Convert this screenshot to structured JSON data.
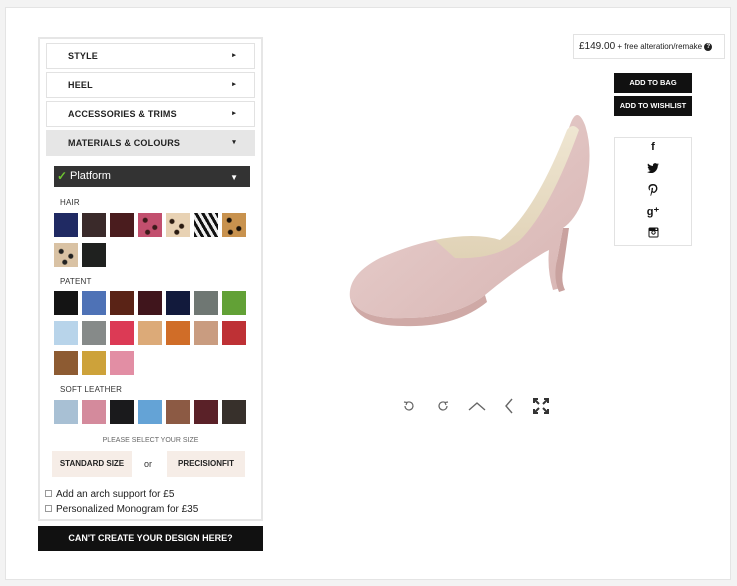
{
  "menu": [
    {
      "label": "STYLE",
      "arrow": "▸"
    },
    {
      "label": "HEEL",
      "arrow": "▸"
    },
    {
      "label": "ACCESSORIES & TRIMS",
      "arrow": "▸"
    },
    {
      "label": "MATERIALS & COLOURS",
      "arrow": "▾"
    }
  ],
  "material_select": {
    "check": "✓",
    "value": "Platform",
    "caret": "▼"
  },
  "sections": {
    "hair": "HAIR",
    "patent": "PATENT",
    "soft_leather": "SOFT LEATHER"
  },
  "swatches": {
    "hair": [
      "#202a63",
      "#3a2a2a",
      "#4a1c1e",
      "leopard-pink",
      "leopard-tan",
      "zebra",
      "leopard-brown",
      "leopard-light",
      "#1f211f"
    ],
    "patent": [
      "#141414",
      "#4e72b6",
      "#5a2316",
      "#40151c",
      "#121a3c",
      "#6f7773",
      "#62a136",
      "#b8d4ea",
      "#868a89",
      "#dc3a55",
      "#dcaa78",
      "#d06d28",
      "#c99c80",
      "#be3135",
      "#8d5b32",
      "#cda23a",
      "#e28ea4"
    ],
    "soft_leather": [
      "#a8c0d4",
      "#d48a9c",
      "#1a1a1c",
      "#64a3d6",
      "#8c5a44",
      "#5a2128",
      "#37302b"
    ]
  },
  "size": {
    "prompt": "PLEASE SELECT YOUR SIZE",
    "standard": "STANDARD SIZE",
    "or": "or",
    "precision": "PRECISIONFIT"
  },
  "options": [
    {
      "label": "Add an arch support for £5"
    },
    {
      "label": "Personalized Monogram for £35"
    }
  ],
  "cant_create": "CAN'T CREATE YOUR DESIGN HERE?",
  "price": {
    "amount": "£149.00",
    "note": " + free alteration/remake ",
    "help": "?"
  },
  "actions": {
    "add_to_bag": "ADD TO BAG",
    "add_to_wishlist": "ADD TO WISHLIST"
  },
  "social": [
    "facebook-icon",
    "twitter-icon",
    "pinterest-icon",
    "google-plus-icon",
    "instagram-icon"
  ],
  "social_glyphs": {
    "f": "f",
    "g": "g⁺"
  },
  "viewer_controls": [
    "rotate-left-icon",
    "rotate-right-icon",
    "view-top-icon",
    "view-side-icon",
    "fullscreen-icon"
  ],
  "colors": {
    "accent": "#6ec531",
    "dark": "#111111",
    "shoe": "#e2c5c3"
  }
}
